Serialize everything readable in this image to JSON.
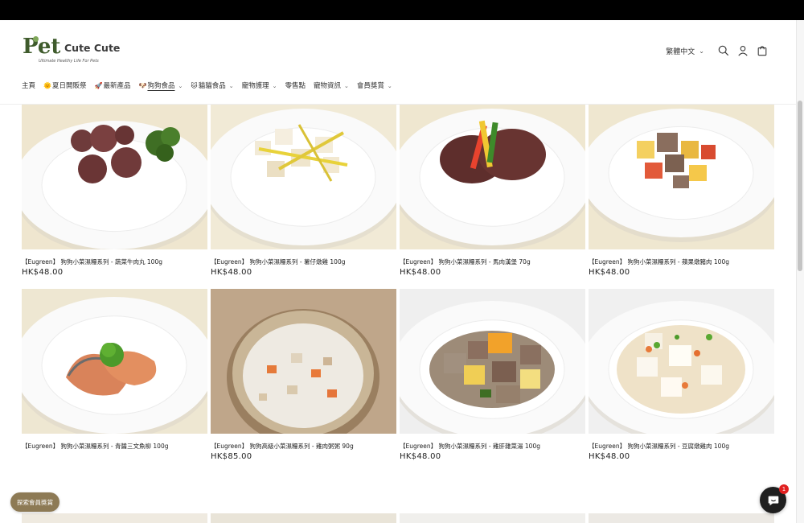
{
  "header": {
    "logo_main": "Pet",
    "logo_secondary": "Cute Cute",
    "logo_tagline": "Ultimate Healthy Life For Pets",
    "language": "繁體中文"
  },
  "nav": [
    {
      "label": "主頁",
      "emoji": "",
      "has_dropdown": false,
      "active": false
    },
    {
      "label": "夏日開販祭",
      "emoji": "🌞",
      "has_dropdown": false,
      "active": false
    },
    {
      "label": "最新產品",
      "emoji": "🚀",
      "has_dropdown": false,
      "active": false
    },
    {
      "label": "狗狗食品",
      "emoji": "🐶",
      "has_dropdown": true,
      "active": true
    },
    {
      "label": "貓貓食品",
      "emoji": "🐱",
      "has_dropdown": true,
      "active": false
    },
    {
      "label": "寵物護理",
      "emoji": "",
      "has_dropdown": true,
      "active": false
    },
    {
      "label": "零售點",
      "emoji": "",
      "has_dropdown": false,
      "active": false
    },
    {
      "label": "寵物資訊",
      "emoji": "",
      "has_dropdown": true,
      "active": false
    },
    {
      "label": "會員獎賞",
      "emoji": "",
      "has_dropdown": true,
      "active": false
    }
  ],
  "products": [
    {
      "title": "【Eugreen】 狗狗小菜濕糧系列 - 蔬菜牛肉丸 100g",
      "price": "HK$48.00",
      "dish": "meatballs"
    },
    {
      "title": "【Eugreen】 狗狗小菜濕糧系列 - 薯仔燉雞 100g",
      "price": "HK$48.00",
      "dish": "chicken-potato"
    },
    {
      "title": "【Eugreen】 狗狗小菜濕糧系列 - 馬肉漢堡 70g",
      "price": "HK$48.00",
      "dish": "burger"
    },
    {
      "title": "【Eugreen】 狗狗小菜濕糧系列 - 蘋果燉豬肉 100g",
      "price": "HK$48.00",
      "dish": "apple-pork"
    },
    {
      "title": "【Eugreen】 狗狗小菜濕糧系列 - 青醬三文魚柳 100g",
      "price": "",
      "dish": "salmon"
    },
    {
      "title": "【Eugreen】 狗狗高級小菜濕糧系列 - 雞肉粥粥 90g",
      "price": "HK$85.00",
      "dish": "porridge"
    },
    {
      "title": "【Eugreen】 狗狗小菜濕糧系列 - 雞肝雜菜湯 100g",
      "price": "HK$48.00",
      "dish": "liver-stew"
    },
    {
      "title": "【Eugreen】 狗狗小菜濕糧系列 - 豆腐燉雞肉 100g",
      "price": "HK$48.00",
      "dish": "tofu-chicken"
    }
  ],
  "member_button": "探索會員獎賞",
  "chat": {
    "badge": "1"
  }
}
